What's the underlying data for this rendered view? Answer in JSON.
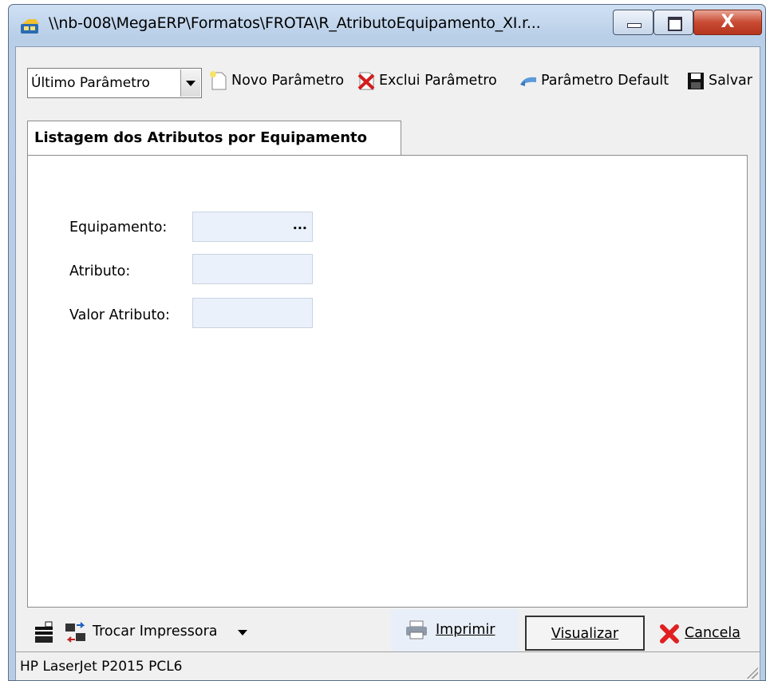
{
  "window": {
    "title": "\\\\nb-008\\MegaERP\\Formatos\\FROTA\\R_AtributoEquipamento_XI.r...",
    "close_glyph": "X"
  },
  "toolbar": {
    "param_select": {
      "selected": "Último Parâmetro"
    },
    "novo_parametro": "Novo Parâmetro",
    "exclui_parametro": "Exclui Parâmetro",
    "parametro_default": "Parâmetro Default",
    "salvar": "Salvar"
  },
  "tab": {
    "label": "Listagem dos Atributos por Equipamento"
  },
  "form": {
    "equipamento_label": "Equipamento:",
    "atributo_label": "Atributo:",
    "valor_atributo_label": "Valor Atributo:",
    "lookup_button": "..."
  },
  "bottom": {
    "trocar_impressora": "Trocar Impressora",
    "imprimir": "Imprimir",
    "visualizar": "Visualizar",
    "cancela": "Cancela"
  },
  "status": {
    "printer": "HP LaserJet P2015 PCL6"
  },
  "colors": {
    "field_bg": "#eaf1fb",
    "title_bar": "#b9cfe8",
    "close_red": "#c94b33"
  },
  "icons": [
    "app-icon",
    "new-document-icon",
    "delete-x-icon",
    "default-arrow-icon",
    "floppy-disk-icon",
    "printer-settings-icon",
    "swap-printer-icon",
    "printer-icon",
    "cancel-x-icon"
  ]
}
